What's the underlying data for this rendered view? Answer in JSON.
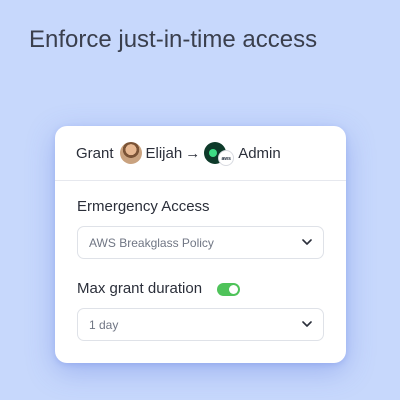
{
  "headline": "Enforce just-in-time access",
  "card": {
    "grant_label": "Grant",
    "user_name": "Elijah",
    "arrow": "→",
    "aws_badge": "aws",
    "role_name": "Admin",
    "policy_label": "Ermergency Access",
    "policy_value": "AWS Breakglass Policy",
    "duration_label": "Max grant duration",
    "duration_toggle_on": true,
    "duration_value": "1 day"
  },
  "colors": {
    "background": "#c7d8fc",
    "toggle_on": "#4fc35a",
    "key_badge": "#0e3a2a"
  },
  "icons": {
    "avatar": "user-avatar",
    "key": "key-icon",
    "aws_logo": "aws-logo-icon",
    "chevron": "chevron-down-icon"
  }
}
